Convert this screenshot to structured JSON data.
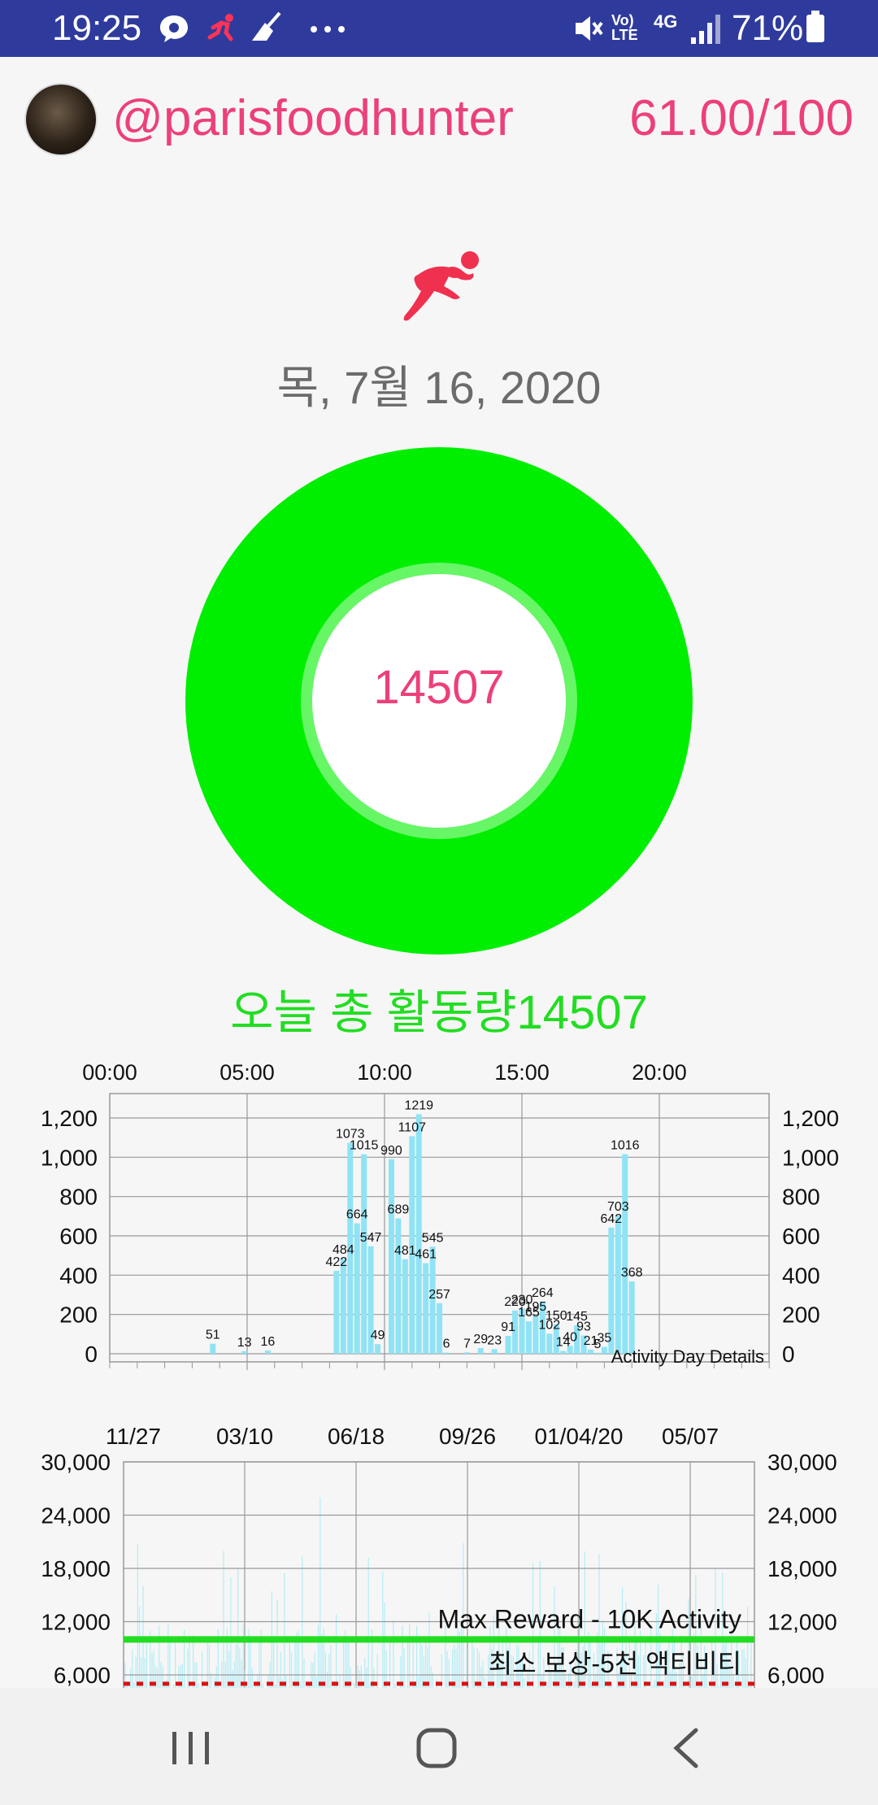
{
  "status_bar": {
    "time": "19:25",
    "battery": "71%",
    "network": "4G",
    "lte_label": "Vo) LTE",
    "icons": [
      "chat-bubble-icon",
      "runner-icon",
      "broom-icon",
      "more-dots-icon",
      "mute-icon",
      "volte-icon",
      "signal-icon",
      "battery-icon"
    ]
  },
  "header": {
    "username": "@parisfoodhunter",
    "score": "61.00/100"
  },
  "date": "목, 7월 16, 2020",
  "ring": {
    "value": "14507",
    "color": "#00ee00"
  },
  "activity_total": "오늘 총 활동량14507",
  "colors": {
    "accent": "#ec407a",
    "green": "#00ee00",
    "bar": "#8fe3f5",
    "status_bar": "#2f3b9c"
  },
  "chart_data": [
    {
      "type": "bar",
      "xlabel": "",
      "ylabel": "",
      "x_ticks": [
        "00:00",
        "05:00",
        "10:00",
        "15:00",
        "20:00"
      ],
      "y_ticks": [
        "1,200",
        "1,000",
        "800",
        "600",
        "400",
        "200",
        "0"
      ],
      "ylim": [
        0,
        1300
      ],
      "xlim_hours": [
        0,
        24
      ],
      "annotation": "Activity Day Details",
      "grid": true,
      "points": [
        {
          "h": 3.75,
          "v": 51,
          "label": "51"
        },
        {
          "h": 4.9,
          "v": 13,
          "label": "13"
        },
        {
          "h": 5.75,
          "v": 16,
          "label": "16"
        },
        {
          "h": 8.25,
          "v": 422,
          "label": "422"
        },
        {
          "h": 8.5,
          "v": 484,
          "label": "484"
        },
        {
          "h": 8.75,
          "v": 1073,
          "label": "1073"
        },
        {
          "h": 9.0,
          "v": 664,
          "label": "664"
        },
        {
          "h": 9.25,
          "v": 1015,
          "label": "1015"
        },
        {
          "h": 9.5,
          "v": 547,
          "label": "547"
        },
        {
          "h": 9.75,
          "v": 49,
          "label": "49"
        },
        {
          "h": 10.25,
          "v": 990,
          "label": "990"
        },
        {
          "h": 10.5,
          "v": 689,
          "label": "689"
        },
        {
          "h": 10.75,
          "v": 481,
          "label": "481"
        },
        {
          "h": 11.0,
          "v": 1107,
          "label": "1107"
        },
        {
          "h": 11.25,
          "v": 1219,
          "label": "1219"
        },
        {
          "h": 11.5,
          "v": 461,
          "label": "461"
        },
        {
          "h": 11.75,
          "v": 545,
          "label": "545"
        },
        {
          "h": 12.0,
          "v": 257,
          "label": "257"
        },
        {
          "h": 12.25,
          "v": 6,
          "label": "6"
        },
        {
          "h": 13.0,
          "v": 7,
          "label": "7"
        },
        {
          "h": 13.5,
          "v": 29,
          "label": "29"
        },
        {
          "h": 14.0,
          "v": 23,
          "label": "23"
        },
        {
          "h": 14.5,
          "v": 91,
          "label": "91"
        },
        {
          "h": 14.75,
          "v": 220,
          "label": "220"
        },
        {
          "h": 15.0,
          "v": 230,
          "label": "230"
        },
        {
          "h": 15.25,
          "v": 165,
          "label": "165"
        },
        {
          "h": 15.5,
          "v": 195,
          "label": "195"
        },
        {
          "h": 15.75,
          "v": 264,
          "label": "264"
        },
        {
          "h": 16.0,
          "v": 102,
          "label": "102"
        },
        {
          "h": 16.25,
          "v": 150,
          "label": "150"
        },
        {
          "h": 16.5,
          "v": 14,
          "label": "14"
        },
        {
          "h": 16.75,
          "v": 40,
          "label": "40"
        },
        {
          "h": 17.0,
          "v": 145,
          "label": "145"
        },
        {
          "h": 17.25,
          "v": 93,
          "label": "93"
        },
        {
          "h": 17.5,
          "v": 21,
          "label": "21"
        },
        {
          "h": 17.75,
          "v": 5,
          "label": "5"
        },
        {
          "h": 18.0,
          "v": 35,
          "label": "35"
        },
        {
          "h": 18.25,
          "v": 642,
          "label": "642"
        },
        {
          "h": 18.5,
          "v": 703,
          "label": "703"
        },
        {
          "h": 18.75,
          "v": 1016,
          "label": "1016"
        },
        {
          "h": 19.0,
          "v": 368,
          "label": "368"
        }
      ]
    },
    {
      "type": "bar",
      "xlabel": "",
      "ylabel": "",
      "x_ticks": [
        "11/27",
        "03/10",
        "06/18",
        "09/26",
        "01/04/20",
        "05/07"
      ],
      "y_ticks": [
        "30,000",
        "24,000",
        "18,000",
        "12,000",
        "6,000"
      ],
      "ylim": [
        0,
        30000
      ],
      "reference_lines": [
        {
          "label": "Max Reward - 10K Activity",
          "value": 10000,
          "color": "#22dd22",
          "style": "solid"
        },
        {
          "label": "최소 보상-5천 액티비티",
          "value": 5000,
          "color": "#dd1111",
          "style": "dotted"
        }
      ],
      "notable_peaks": [
        26000,
        25000,
        26000,
        24000,
        22000
      ],
      "grid": true
    }
  ],
  "nav": {
    "recents": "recents-icon",
    "home": "home-icon",
    "back": "back-icon"
  }
}
